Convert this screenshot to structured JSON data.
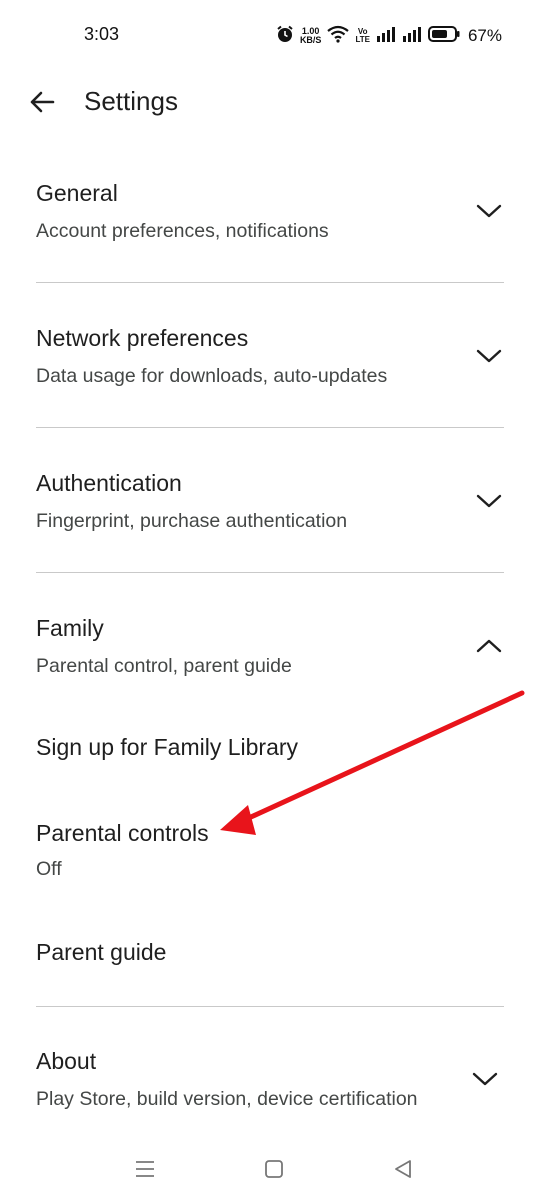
{
  "status": {
    "time": "3:03",
    "speed_value": "1.00",
    "speed_unit": "KB/S",
    "volte_top": "Vo",
    "volte_bottom": "LTE",
    "battery": "67%"
  },
  "header": {
    "title": "Settings"
  },
  "sections": {
    "general": {
      "title": "General",
      "subtitle": "Account preferences, notifications"
    },
    "network": {
      "title": "Network preferences",
      "subtitle": "Data usage for downloads, auto-updates"
    },
    "authentication": {
      "title": "Authentication",
      "subtitle": "Fingerprint, purchase authentication"
    },
    "family": {
      "title": "Family",
      "subtitle": "Parental control, parent guide",
      "items": {
        "family_library": {
          "title": "Sign up for Family Library"
        },
        "parental_controls": {
          "title": "Parental controls",
          "value": "Off"
        },
        "parent_guide": {
          "title": "Parent guide"
        }
      }
    },
    "about": {
      "title": "About",
      "subtitle": "Play Store, build version, device certification"
    }
  },
  "annotation": {
    "color": "#e8141b"
  }
}
